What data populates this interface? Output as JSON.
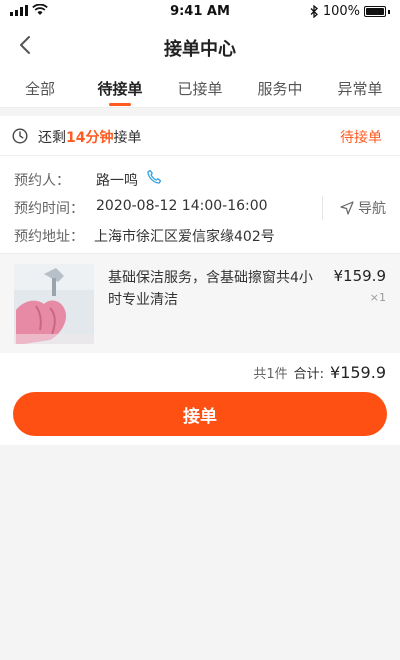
{
  "status_bar": {
    "time": "9:41 AM",
    "battery": "100%"
  },
  "header": {
    "title": "接单中心"
  },
  "tabs": [
    {
      "label": "全部",
      "active": false
    },
    {
      "label": "待接单",
      "active": true
    },
    {
      "label": "已接单",
      "active": false
    },
    {
      "label": "服务中",
      "active": false
    },
    {
      "label": "异常单",
      "active": false
    }
  ],
  "order": {
    "countdown_prefix": "还剩",
    "countdown_value": "14分钟",
    "countdown_suffix": "接单",
    "status": "待接单",
    "booker_label": "预约人：",
    "booker_name": "路一鸣",
    "time_label": "预约时间：",
    "time_value": "2020-08-12 14:00-16:00",
    "navigate_label": "导航",
    "address_label": "预约地址：",
    "address_value": "上海市徐汇区爱信家缘402号",
    "item": {
      "name": "基础保洁服务，含基础擦窗共4小时专业清洁",
      "price": "¥159.9",
      "quantity": "×1"
    },
    "summary": {
      "count_text": "共1件",
      "total_label": "合计:",
      "total_value": "¥159.9"
    }
  },
  "actions": {
    "accept_label": "接单"
  },
  "colors": {
    "accent": "#ff5a1f",
    "button": "#ff5014",
    "phone_icon": "#3aa0e0"
  },
  "icons": [
    "back-icon",
    "clock-icon",
    "phone-icon",
    "navigate-arrow-icon",
    "wifi-icon",
    "signal-icon",
    "bluetooth-icon",
    "battery-icon"
  ]
}
